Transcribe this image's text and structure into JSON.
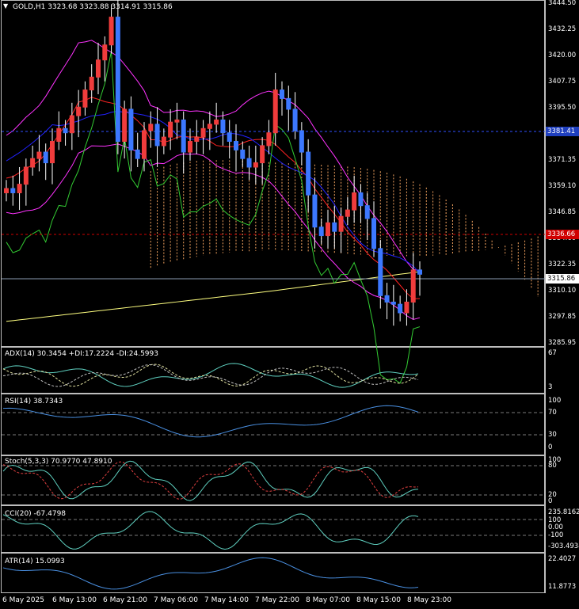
{
  "main": {
    "header": "GOLD,H1  3323.68 3323.88 3314.91 3315.86",
    "y_ticks": [
      "3444.50",
      "3432.25",
      "3420.00",
      "3407.75",
      "3395.50",
      "3383.25",
      "3371.35",
      "3359.10",
      "3346.85",
      "3334.60",
      "3322.35",
      "3310.10",
      "3297.85",
      "3285.95"
    ],
    "current_price_label": "3315.86",
    "red_level_label": "3336.66",
    "blue_level_label": "3381.41"
  },
  "adx": {
    "label": "ADX(14) 30.3454 +DI:17.2224 -DI:24.5993",
    "ticks": [
      "67",
      "3"
    ]
  },
  "rsi": {
    "label": "RSI(14) 38.7343",
    "ticks": [
      "100",
      "70",
      "30",
      "0"
    ]
  },
  "stoch": {
    "label": "Stoch(5,3,3) 70.9770 47.8910",
    "ticks": [
      "100",
      "80",
      "20",
      "0"
    ]
  },
  "cci": {
    "label": "CCI(20) -67.4798",
    "ticks": [
      "235.8162",
      "100",
      "0.00",
      "-100",
      "-303.4934"
    ]
  },
  "atr": {
    "label": "ATR(14) 15.0993",
    "ticks": [
      "22.4027",
      "11.8773"
    ]
  },
  "x_ticks": [
    "6 May 2025",
    "6 May 13:00",
    "6 May 21:00",
    "7 May 06:00",
    "7 May 14:00",
    "7 May 22:00",
    "8 May 07:00",
    "8 May 15:00",
    "8 May 23:00"
  ],
  "chart_data": {
    "type": "candlestick",
    "symbol": "GOLD",
    "timeframe": "H1",
    "ohlc_last": {
      "open": 3323.68,
      "high": 3323.88,
      "low": 3314.91,
      "close": 3315.86
    },
    "ylim": [
      3285.95,
      3444.5
    ],
    "closes": [
      3358,
      3356,
      3360,
      3368,
      3372,
      3375,
      3370,
      3380,
      3386,
      3384,
      3392,
      3396,
      3404,
      3410,
      3418,
      3425,
      3438,
      3380,
      3395,
      3376,
      3372,
      3385,
      3388,
      3378,
      3382,
      3389,
      3390,
      3375,
      3380,
      3382,
      3386,
      3388,
      3390,
      3384,
      3380,
      3376,
      3372,
      3368,
      3370,
      3378,
      3384,
      3404,
      3400,
      3395,
      3385,
      3375,
      3355,
      3340,
      3336,
      3342,
      3338,
      3345,
      3348,
      3356,
      3350,
      3344,
      3330,
      3308,
      3305,
      3304,
      3300,
      3305,
      3320,
      3318
    ],
    "colors": {
      "bull": "#f03c3c",
      "bear": "#3c78ff",
      "ma": "#ffff80",
      "bb": "#ff33ff",
      "ichimoku_cloud": "#f4a460",
      "tenkan": "#ff2222",
      "kijun": "#2222ff",
      "chikou": "#33cc33"
    }
  }
}
